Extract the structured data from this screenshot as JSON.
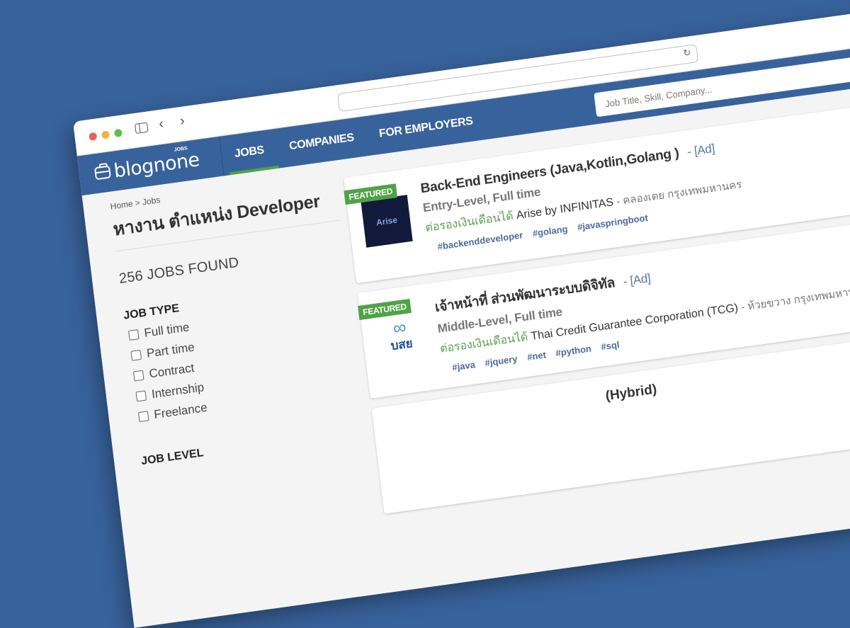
{
  "browser": {
    "traffic_lights": [
      "#ec5f57",
      "#f0b43c",
      "#5dc04d"
    ],
    "back_icon": "chevron-left-icon",
    "forward_icon": "chevron-right-icon",
    "reload_glyph": "↻"
  },
  "header": {
    "logo_text": "blognone",
    "logo_sup": "JOBS",
    "nav": [
      {
        "label": "JOBS",
        "active": true
      },
      {
        "label": "COMPANIES",
        "active": false
      },
      {
        "label": "FOR EMPLOYERS",
        "active": false
      }
    ],
    "search_placeholder": "Job Title, Skill, Company..."
  },
  "breadcrumb": {
    "home": "Home",
    "sep": ">",
    "current": "Jobs"
  },
  "page_title": "หางาน ตำแหน่ง Developer",
  "jobs_found": "256 JOBS FOUND",
  "filters": {
    "job_type": {
      "title": "JOB TYPE",
      "options": [
        "Full time",
        "Part time",
        "Contract",
        "Internship",
        "Freelance"
      ]
    },
    "job_level": {
      "title": "JOB LEVEL"
    }
  },
  "jobs": [
    {
      "badge": "FEATURED",
      "logo_text": "Arise",
      "title": "Back-End Engineers (Java,Kotlin,Golang )",
      "ad": "- [Ad]",
      "level": "Entry-Level, Full time",
      "salary": "ต่อรองเงินเดือนได้",
      "company": "Arise by INFINITAS",
      "location": "- คลองเตย กรุงเทพมหานคร",
      "tags": [
        "#backenddeveloper",
        "#golang",
        "#javaspringboot"
      ]
    },
    {
      "badge": "FEATURED",
      "logo_symbol": "∞",
      "logo_text": "บสย",
      "title": "เจ้าหน้าที่ ส่วนพัฒนาระบบดิจิทัล",
      "ad": "- [Ad]",
      "level": "Middle-Level, Full time",
      "salary": "ต่อรองเงินเดือนได้",
      "company": "Thai Credit Guarantee Corporation (TCG)",
      "location": "- ห้วยขวาง กรุงเทพมหานคร",
      "tags": [
        "#java",
        "#jquery",
        "#net",
        "#python",
        "#sql"
      ]
    },
    {
      "title_partial": "(Hybrid)"
    }
  ]
}
